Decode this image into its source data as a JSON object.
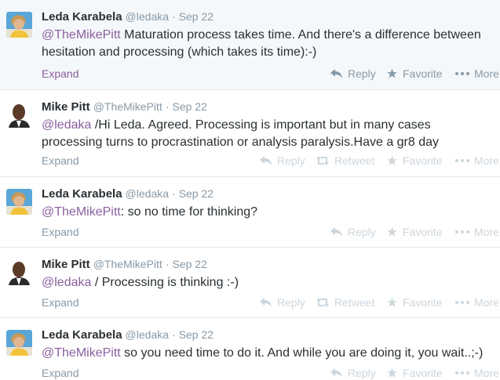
{
  "tweets": [
    {
      "fullname": "Leda Karabela",
      "username": "@ledaka",
      "time": "Sep 22",
      "mention": "@TheMikePitt",
      "text": " Maturation process takes time. And there's a difference between hesitation and processing (which takes its time):-)",
      "expand": "Expand",
      "actions": {
        "reply": "Reply",
        "favorite": "Favorite",
        "more": "More"
      }
    },
    {
      "fullname": "Mike Pitt",
      "username": "@TheMikePitt",
      "time": "Sep 22",
      "mention": "@ledaka",
      "text": " /Hi Leda. Agreed. Processing is important but in many cases processing turns to procrastination or analysis paralysis.Have a gr8 day",
      "expand": "Expand",
      "actions": {
        "reply": "Reply",
        "retweet": "Retweet",
        "favorite": "Favorite",
        "more": "More"
      }
    },
    {
      "fullname": "Leda Karabela",
      "username": "@ledaka",
      "time": "Sep 22",
      "mention": "@TheMikePitt",
      "text": ": so no time for thinking?",
      "expand": "Expand",
      "actions": {
        "reply": "Reply",
        "favorite": "Favorite",
        "more": "More"
      }
    },
    {
      "fullname": "Mike Pitt",
      "username": "@TheMikePitt",
      "time": "Sep 22",
      "mention": "@ledaka",
      "text": " / Processing is thinking :-)",
      "expand": "Expand",
      "actions": {
        "reply": "Reply",
        "retweet": "Retweet",
        "favorite": "Favorite",
        "more": "More"
      }
    },
    {
      "fullname": "Leda Karabela",
      "username": "@ledaka",
      "time": "Sep 22",
      "mention": "@TheMikePitt",
      "text": " so you need time to do it. And while you are doing it, you wait..;-)",
      "expand": "Expand",
      "actions": {
        "reply": "Reply",
        "favorite": "Favorite",
        "more": "More"
      }
    }
  ],
  "colors": {
    "mention": "#8a5f9e",
    "meta": "#8899a6",
    "inactive_action": "#ccd6dd",
    "highlight_bg": "#f5f8fa"
  }
}
